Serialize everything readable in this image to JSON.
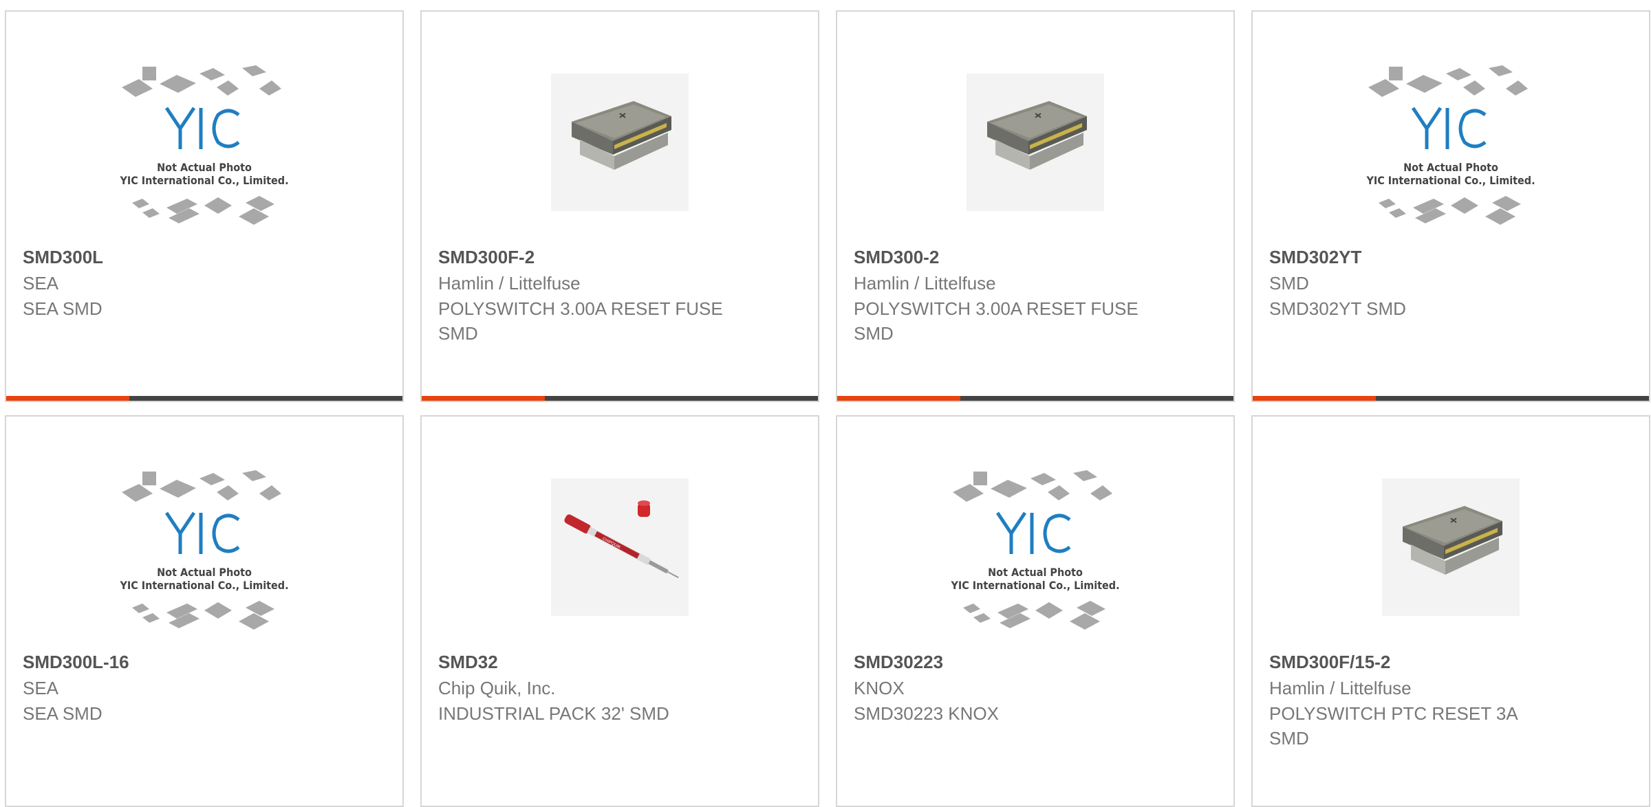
{
  "colors": {
    "accent": "#e8430e",
    "bar": "#444444",
    "border": "#d6d6d6",
    "part_text": "#555555",
    "body_text": "#777777",
    "logo_blue": "#1f7ec1"
  },
  "placeholder": {
    "line1": "Not Actual Photo",
    "line2": "YIC International Co., Limited.",
    "logo": "YIC"
  },
  "products": [
    {
      "part": "SMD300L",
      "maker": "SEA",
      "desc": "SEA SMD",
      "image": "placeholder-icon",
      "progress": 0.31
    },
    {
      "part": "SMD300F-2",
      "maker": "Hamlin / Littelfuse",
      "desc": "POLYSWITCH 3.00A RESET FUSE SMD",
      "image": "polyswitch-fuse-icon",
      "progress": 0.31
    },
    {
      "part": "SMD300-2",
      "maker": "Hamlin / Littelfuse",
      "desc": "POLYSWITCH 3.00A RESET FUSE SMD",
      "image": "polyswitch-fuse-icon",
      "progress": 0.31
    },
    {
      "part": "SMD302YT",
      "maker": "SMD",
      "desc": "SMD302YT SMD",
      "image": "placeholder-icon",
      "progress": 0.31
    },
    {
      "part": "SMD300L-16",
      "maker": "SEA",
      "desc": "SEA SMD",
      "image": "placeholder-icon"
    },
    {
      "part": "SMD32",
      "maker": "Chip Quik, Inc.",
      "desc": "INDUSTRIAL PACK 32' SMD",
      "image": "solder-syringe-icon"
    },
    {
      "part": "SMD30223",
      "maker": "KNOX",
      "desc": "SMD30223 KNOX",
      "image": "placeholder-icon"
    },
    {
      "part": "SMD300F/15-2",
      "maker": "Hamlin / Littelfuse",
      "desc": "POLYSWITCH PTC RESET 3A SMD",
      "image": "polyswitch-fuse-icon"
    }
  ]
}
